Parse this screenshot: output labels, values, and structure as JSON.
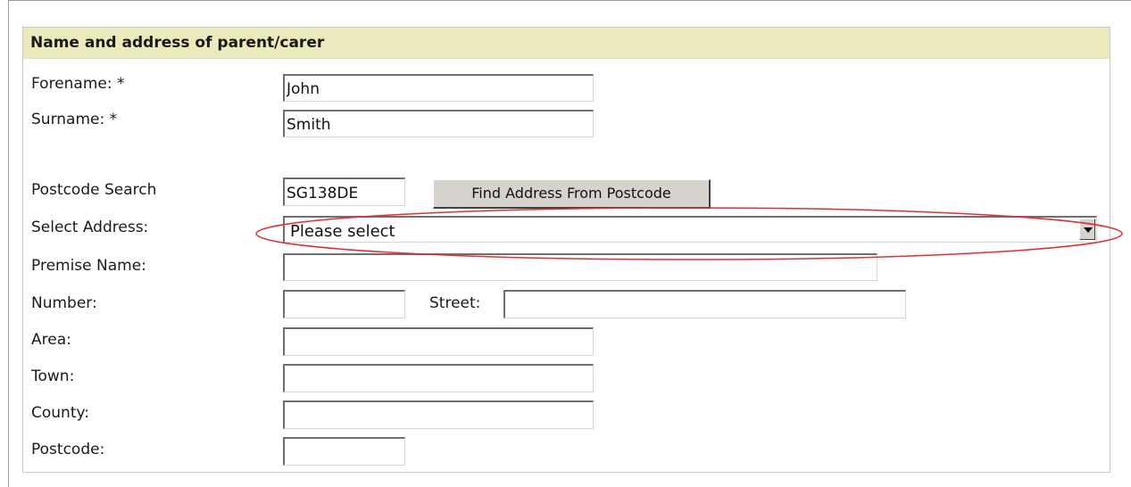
{
  "section": {
    "title": "Name and address of parent/carer"
  },
  "form": {
    "forename": {
      "label": "Forename: *",
      "value": "John"
    },
    "surname": {
      "label": "Surname: *",
      "value": "Smith"
    },
    "postcode_search": {
      "label": "Postcode Search",
      "value": "SG138DE",
      "button_label": "Find Address From Postcode"
    },
    "select_address": {
      "label": "Select Address:",
      "selected": "Please select"
    },
    "premise_name": {
      "label": "Premise Name:",
      "value": ""
    },
    "number": {
      "label": "Number:",
      "value": ""
    },
    "street": {
      "label": "Street:",
      "value": ""
    },
    "area": {
      "label": "Area:",
      "value": ""
    },
    "town": {
      "label": "Town:",
      "value": ""
    },
    "county": {
      "label": "County:",
      "value": ""
    },
    "postcode": {
      "label": "Postcode:",
      "value": ""
    }
  },
  "annotation": {
    "shape": "ellipse",
    "color": "#e03030",
    "target": "select-address-dropdown"
  },
  "icons": {
    "dropdown_arrow": "chevron-down-icon"
  }
}
